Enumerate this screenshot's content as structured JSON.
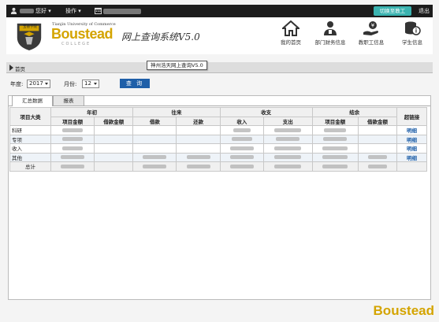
{
  "topbar": {
    "greeting": "您好",
    "ops_menu": "操作",
    "switch_button": "切换至教工",
    "logout": "退出"
  },
  "header": {
    "logo_top": "Tianjin University of Commerce",
    "logo_main": "Boustead",
    "logo_sub": "COLLEGE",
    "logo_badge": "宝德学院",
    "system_title": "网上查询系统V5.0",
    "nav": [
      {
        "label": "我的首页",
        "icon": "home-icon"
      },
      {
        "label": "部门财务信息",
        "icon": "department-user-icon"
      },
      {
        "label": "教职工信息",
        "icon": "staff-money-icon"
      },
      {
        "label": "学生信息",
        "icon": "student-info-icon"
      }
    ]
  },
  "breadcrumb": {
    "current": "首页"
  },
  "tooltip": "神州浩天网上查询V5.0",
  "filters": {
    "year_label": "年度:",
    "year_value": "2017",
    "month_label": "月份:",
    "month_value": "12",
    "query_button": "查 询"
  },
  "tabs": [
    {
      "label": "汇总数据",
      "active": true
    },
    {
      "label": "报表",
      "active": false
    }
  ],
  "table": {
    "group_headers": [
      "项目大类",
      "年初",
      "往来",
      "收支",
      "结余",
      "超链接"
    ],
    "sub_headers": [
      "项目金额",
      "借款金额",
      "借款",
      "还款",
      "收入",
      "支出",
      "项目金额",
      "借款金额"
    ],
    "rows": [
      {
        "category": "科研",
        "link": "明细"
      },
      {
        "category": "专项",
        "link": "明细"
      },
      {
        "category": "收入",
        "link": "明细"
      },
      {
        "category": "其他",
        "link": "明细"
      }
    ],
    "total_label": "总计"
  },
  "watermark": "Boustead"
}
